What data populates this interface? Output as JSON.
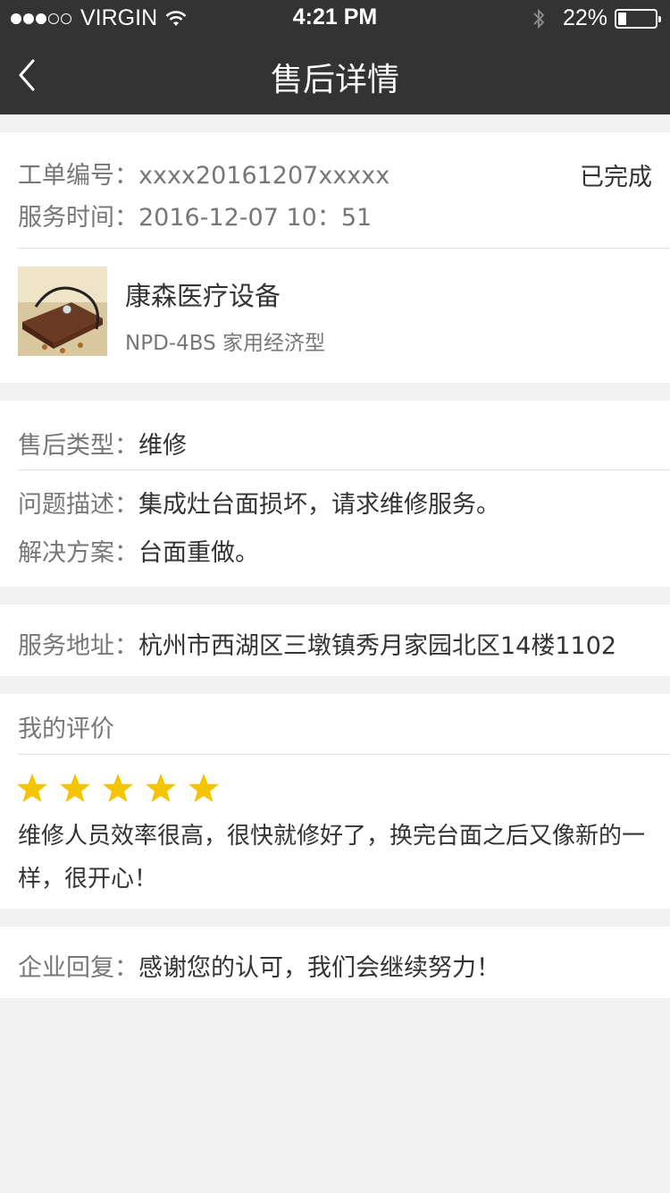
{
  "status_bar": {
    "carrier": "VIRGIN",
    "time": "4:21 PM",
    "battery": "22%",
    "battery_level": 0.22,
    "signal_bars": 3,
    "signal_total": 5
  },
  "nav": {
    "title": "售后详情",
    "back_icon": "chevron-left-icon"
  },
  "order": {
    "number_label": "工单编号：",
    "number_value": "xxxx20161207xxxxx",
    "status": "已完成",
    "time_label": "服务时间：",
    "time_value": "2016-12-07  10：51",
    "product_name": "康森医疗设备",
    "product_model": "NPD-4BS 家用经济型"
  },
  "service": {
    "type_label": "售后类型：",
    "type_value": "维修",
    "problem_label": "问题描述：",
    "problem_value": "集成灶台面损坏，请求维修服务。",
    "solution_label": "解决方案：",
    "solution_value": "台面重做。"
  },
  "address": {
    "label": "服务地址：",
    "value": "杭州市西湖区三墩镇秀月家园北区14楼1102"
  },
  "review": {
    "title": "我的评价",
    "rating": 5,
    "rating_max": 5,
    "star_color": "#f5c400",
    "text": "维修人员效率很高，很快就修好了，换完台面之后又像新的一样，很开心！"
  },
  "reply": {
    "label": "企业回复：",
    "value": "感谢您的认可，我们会继续努力！"
  },
  "colors": {
    "bar": "#333333",
    "background": "#f2f2f2",
    "label": "#777777"
  }
}
